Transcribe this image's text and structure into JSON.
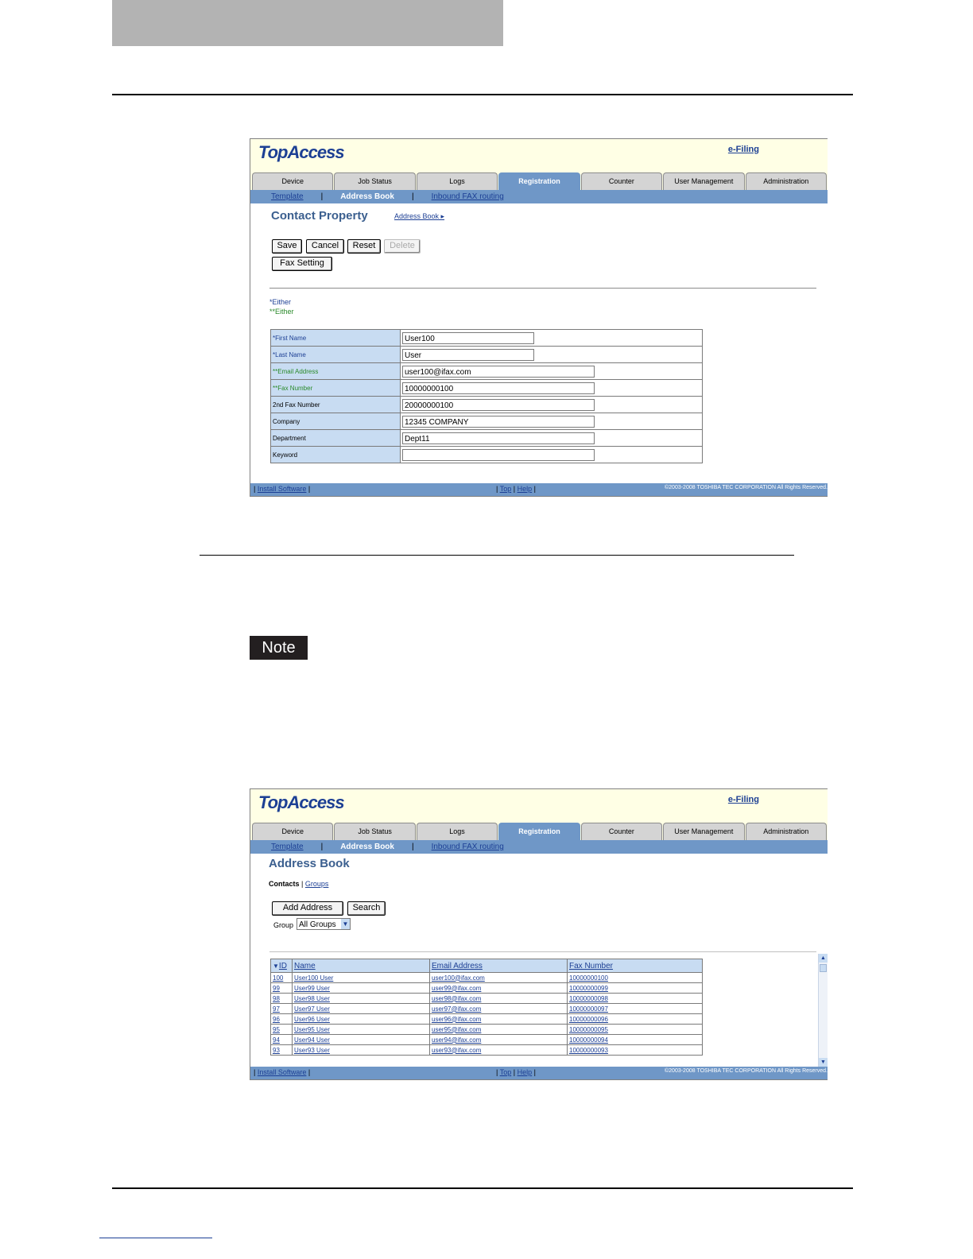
{
  "app": {
    "logo": "TopAccess",
    "efiling": "e-Filing",
    "tabs": [
      "Device",
      "Job Status",
      "Logs",
      "Registration",
      "Counter",
      "User Management",
      "Administration"
    ],
    "active_tab": "Registration",
    "subnav": {
      "template": "Template",
      "address_book": "Address Book",
      "inbound": "Inbound FAX routing",
      "sep": "|"
    },
    "footer": {
      "install": "Install Software",
      "top": "Top",
      "help": "Help",
      "bar": "|",
      "copyright": "©2003-2008 TOSHIBA TEC CORPORATION All Rights Reserved."
    }
  },
  "contact": {
    "title": "Contact Property",
    "address_book_link": "Address Book ▸",
    "buttons": {
      "save": "Save",
      "cancel": "Cancel",
      "reset": "Reset",
      "delete": "Delete",
      "fax_setting": "Fax Setting"
    },
    "either1": "*Either",
    "either2": "**Either",
    "fields": [
      {
        "label": "*First Name",
        "value": "User100"
      },
      {
        "label": "*Last Name",
        "value": "User"
      },
      {
        "label": "**Email Address",
        "value": "user100@ifax.com"
      },
      {
        "label": "**Fax Number",
        "value": "10000000100"
      },
      {
        "label": "2nd Fax Number",
        "value": "20000000100"
      },
      {
        "label": "Company",
        "value": "12345 COMPANY"
      },
      {
        "label": "Department",
        "value": "Dept11"
      },
      {
        "label": "Keyword",
        "value": ""
      }
    ]
  },
  "note": "Note",
  "addressbook": {
    "title": "Address Book",
    "contacts": "Contacts",
    "groups": "Groups",
    "sep": "|",
    "add_address": "Add Address",
    "search": "Search",
    "group_label": "Group",
    "group_value": "All Groups",
    "columns": [
      "ID",
      "Name",
      "Email Address",
      "Fax Number"
    ],
    "rows": [
      [
        "100",
        "User100 User",
        "user100@ifax.com",
        "10000000100"
      ],
      [
        "99",
        "User99 User",
        "user99@ifax.com",
        "10000000099"
      ],
      [
        "98",
        "User98 User",
        "user98@ifax.com",
        "10000000098"
      ],
      [
        "97",
        "User97 User",
        "user97@ifax.com",
        "10000000097"
      ],
      [
        "96",
        "User96 User",
        "user96@ifax.com",
        "10000000096"
      ],
      [
        "95",
        "User95 User",
        "user95@ifax.com",
        "10000000095"
      ],
      [
        "94",
        "User94 User",
        "user94@ifax.com",
        "10000000094"
      ],
      [
        "93",
        "User93 User",
        "user93@ifax.com",
        "10000000093"
      ]
    ]
  }
}
